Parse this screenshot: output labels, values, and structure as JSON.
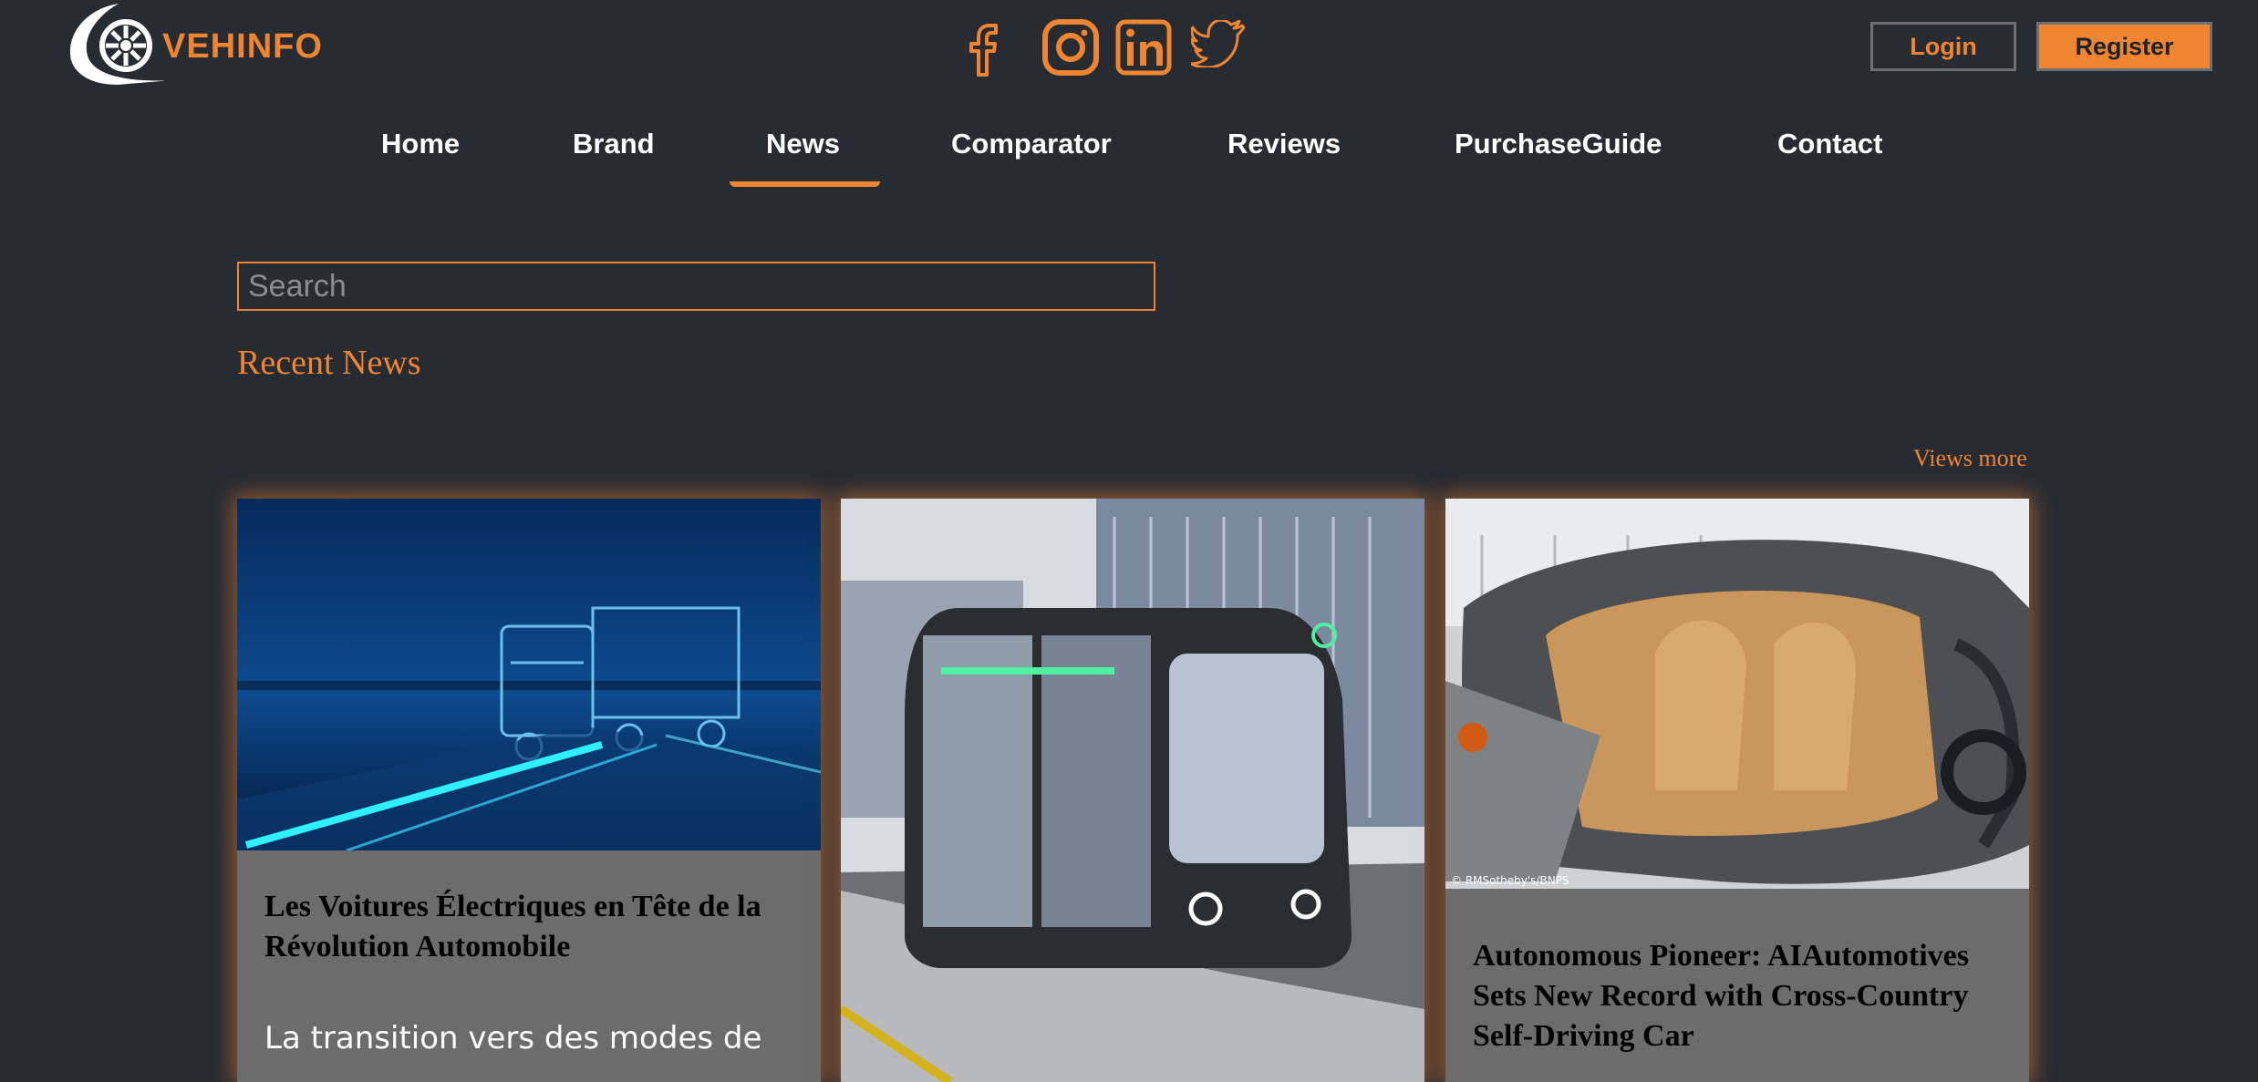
{
  "brand": {
    "name": "VEHINFO",
    "accent": "#ef8431",
    "background": "#272b32",
    "card_bg": "#6c6c6c"
  },
  "header": {
    "social": [
      {
        "icon": "facebook-icon"
      },
      {
        "icon": "instagram-icon"
      },
      {
        "icon": "linkedin-icon"
      },
      {
        "icon": "twitter-icon"
      }
    ],
    "login_label": "Login",
    "register_label": "Register"
  },
  "nav": {
    "items": [
      {
        "label": "Home"
      },
      {
        "label": "Brand"
      },
      {
        "label": "News",
        "active": true
      },
      {
        "label": "Comparator"
      },
      {
        "label": "Reviews"
      },
      {
        "label": "PurchaseGuide"
      },
      {
        "label": "Contact"
      }
    ]
  },
  "search": {
    "placeholder": "Search",
    "value": ""
  },
  "news": {
    "section_title": "Recent News",
    "views_more": "Views more",
    "cards": [
      {
        "image": "electric-truck-image",
        "title": "Les Voitures Électriques en Tête de la Révolution Automobile",
        "excerpt": "La transition vers des modes de"
      },
      {
        "image": "autonomous-tram-image",
        "title": "",
        "excerpt": ""
      },
      {
        "image": "supercar-interior-image",
        "image_credit": "© RMSotheby's/BNPS",
        "title": "Autonomous Pioneer: AIAutomotives Sets New Record with Cross-Country Self-Driving Car",
        "excerpt": ""
      }
    ]
  }
}
